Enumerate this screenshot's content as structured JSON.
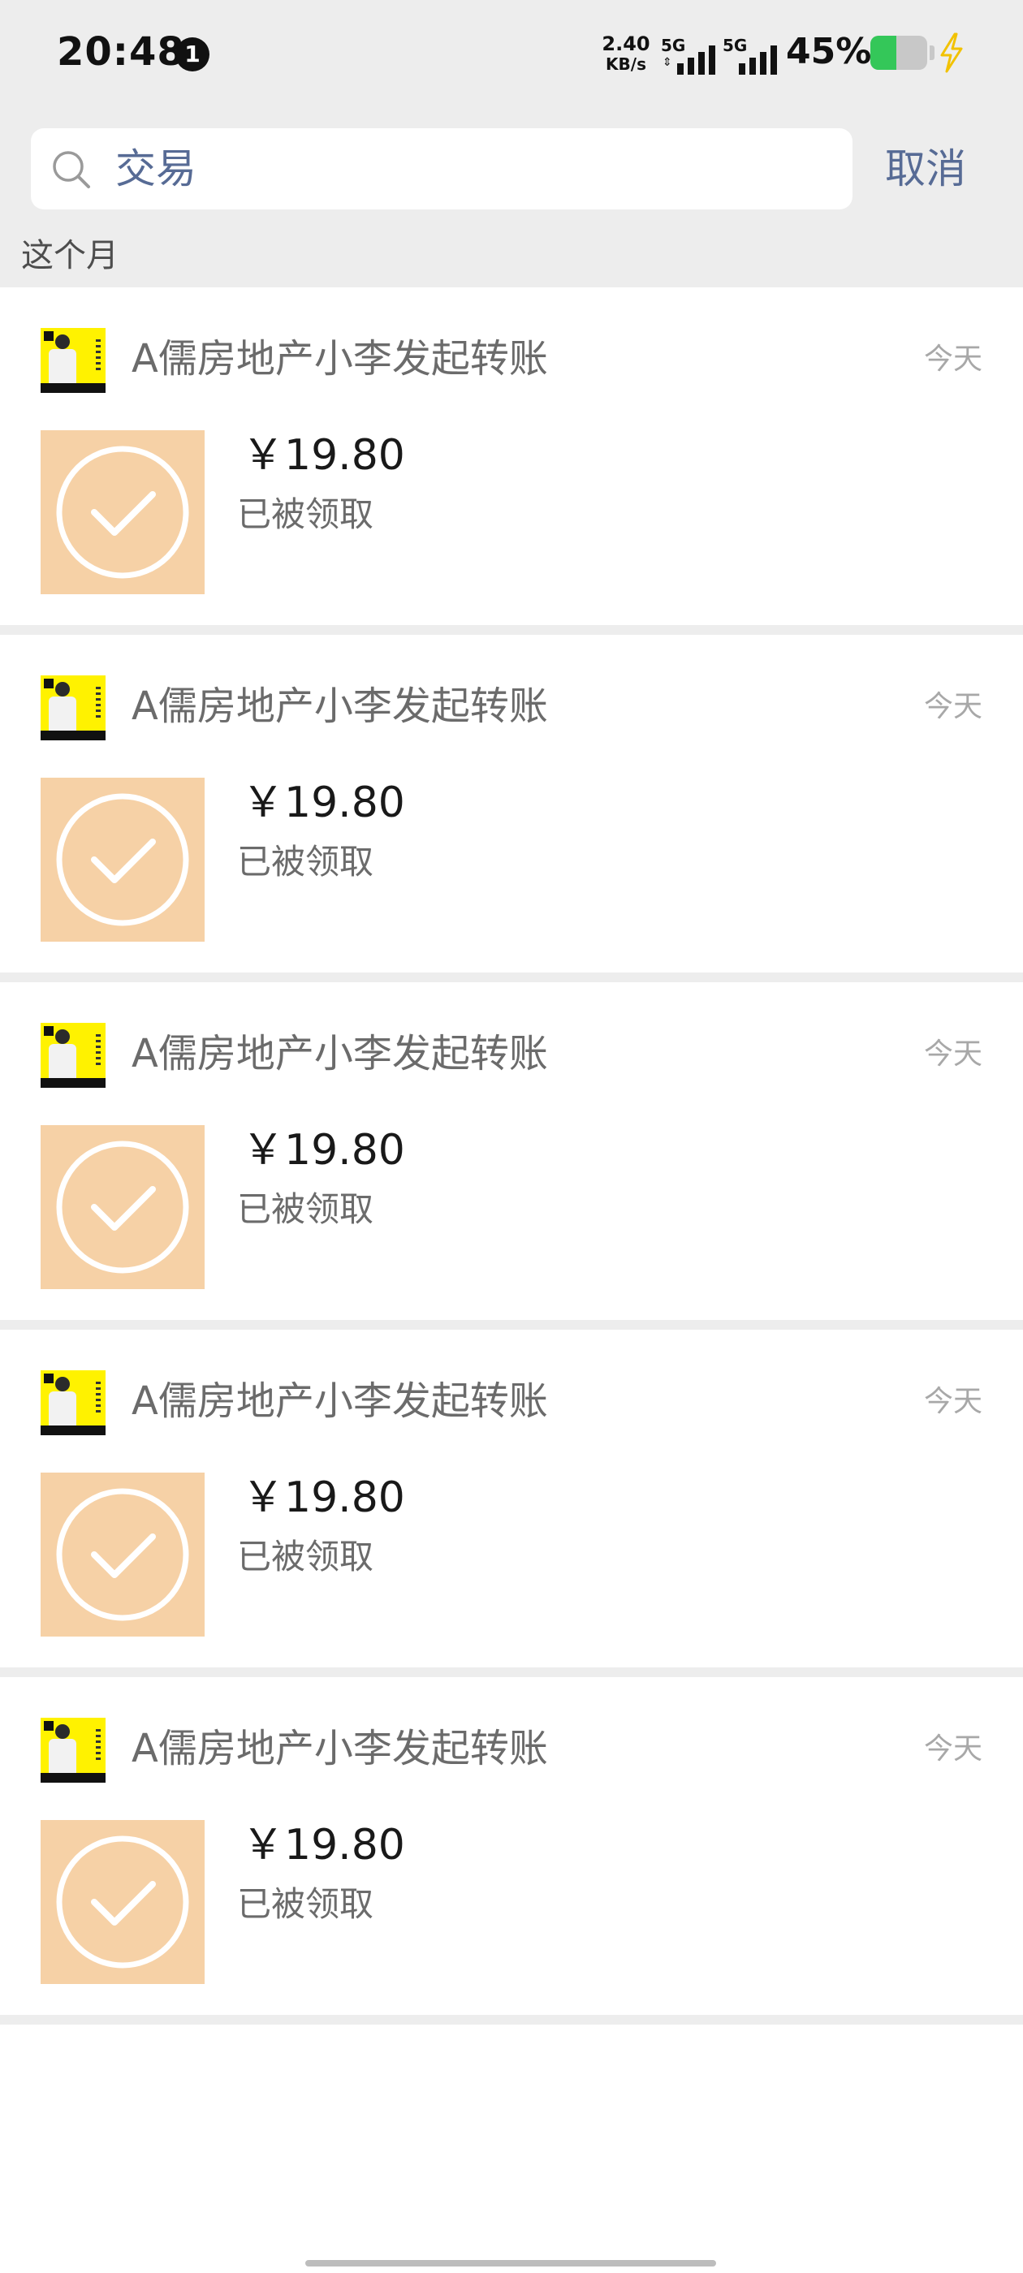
{
  "status_bar": {
    "time": "20:48",
    "notification_count": "1",
    "net_speed_value": "2.40",
    "net_speed_unit": "KB/s",
    "sim1_label": "5G",
    "sim2_label": "5G",
    "battery_percent": "45%",
    "battery_level": 0.45,
    "battery_color": "#34c759",
    "charging_icon": "bolt-icon"
  },
  "search": {
    "query": "交易",
    "cancel_label": "取消",
    "icon": "search-icon"
  },
  "section_label": "这个月",
  "transactions": [
    {
      "title": "A儒房地产小李发起转账",
      "date": "今天",
      "amount": "￥19.80",
      "status": "已被领取"
    },
    {
      "title": "A儒房地产小李发起转账",
      "date": "今天",
      "amount": "￥19.80",
      "status": "已被领取"
    },
    {
      "title": "A儒房地产小李发起转账",
      "date": "今天",
      "amount": "￥19.80",
      "status": "已被领取"
    },
    {
      "title": "A儒房地产小李发起转账",
      "date": "今天",
      "amount": "￥19.80",
      "status": "已被领取"
    },
    {
      "title": "A儒房地产小李发起转账",
      "date": "今天",
      "amount": "￥19.80",
      "status": "已被领取"
    }
  ],
  "colors": {
    "background": "#ededed",
    "link": "#576b95",
    "transfer_icon_bg": "#f6d1a6"
  }
}
